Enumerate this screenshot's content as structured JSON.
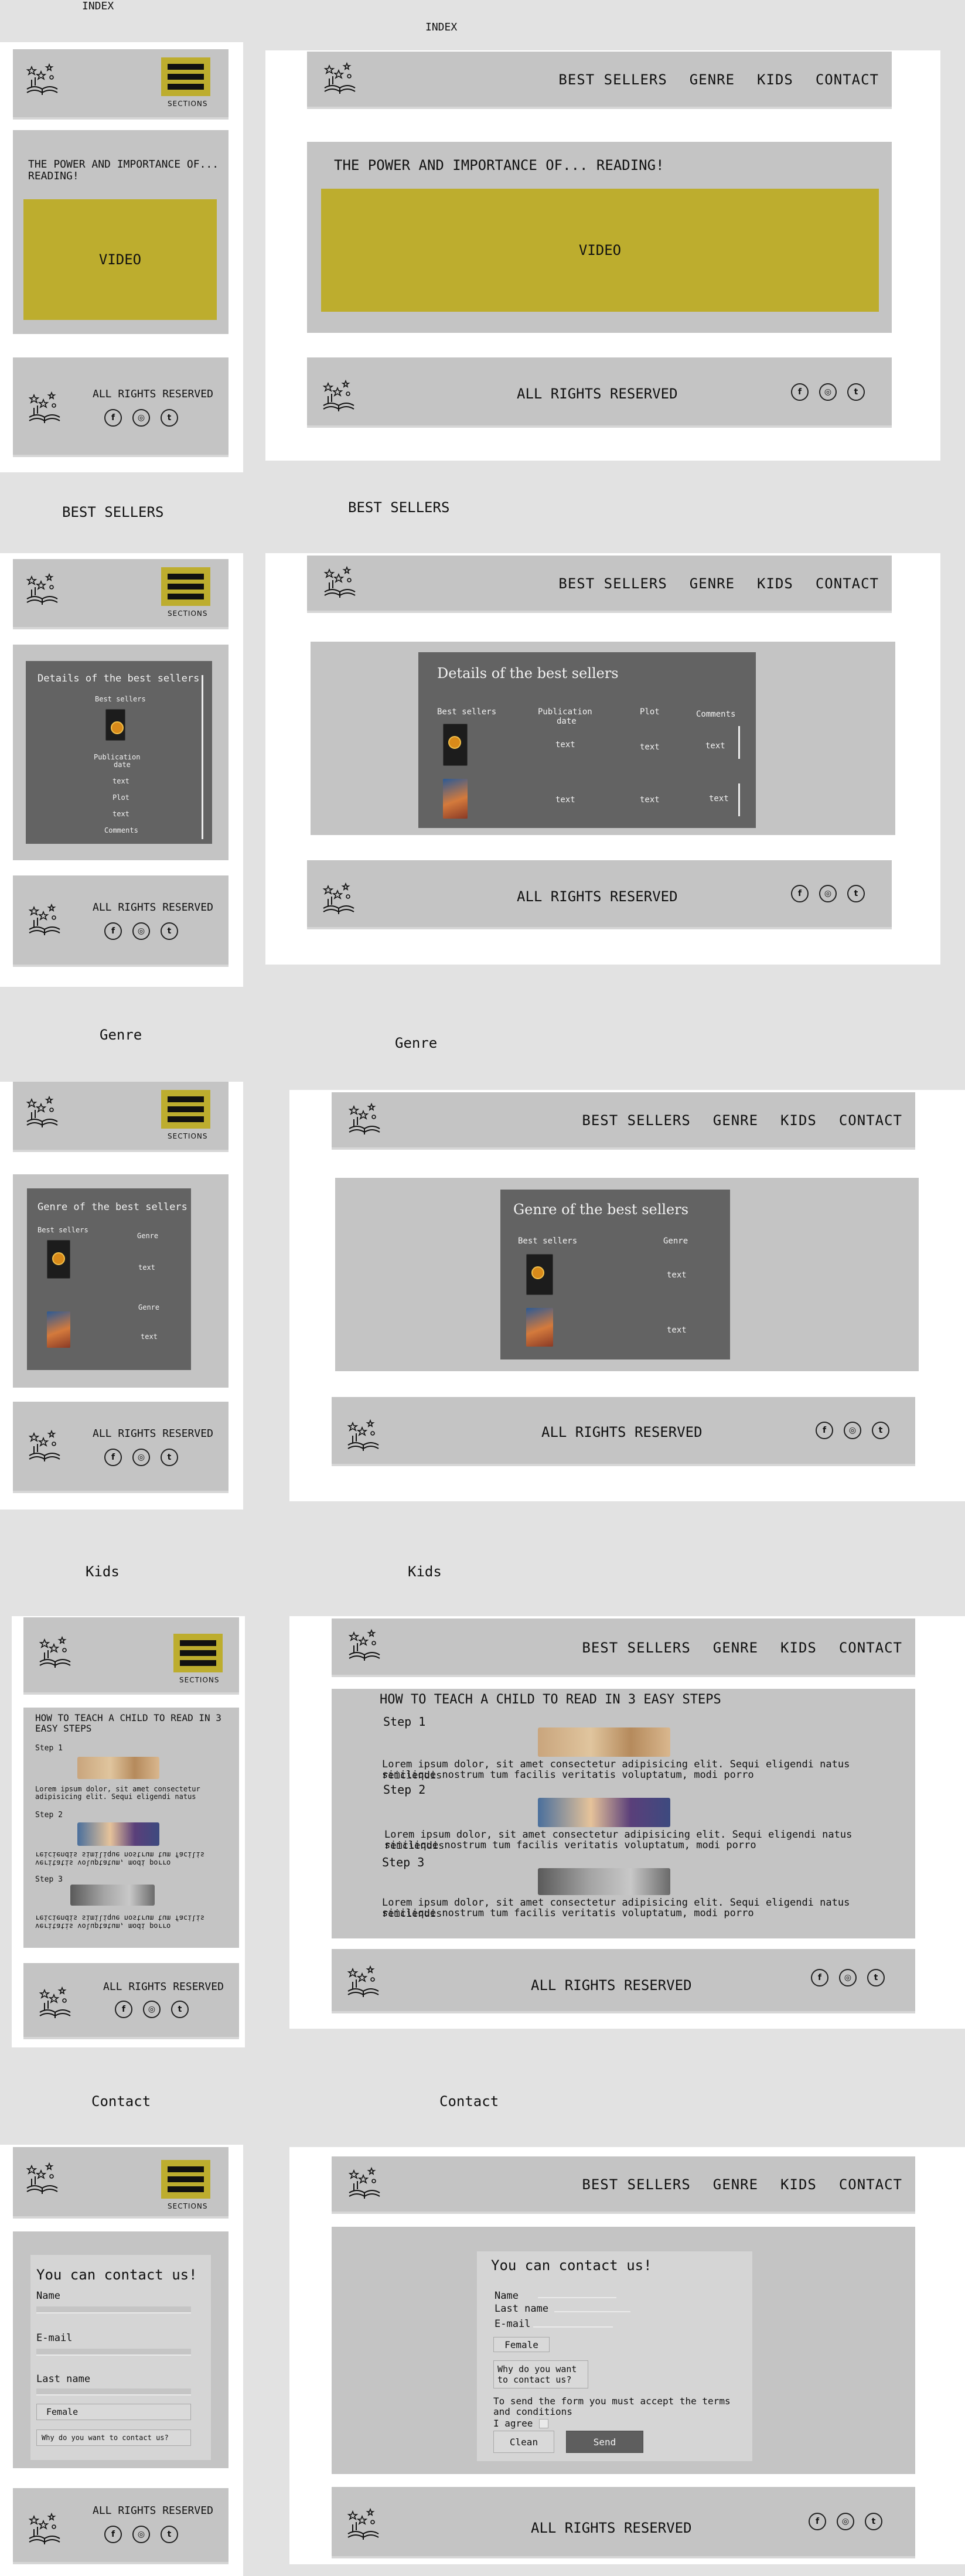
{
  "brand": {
    "sections_label": "SECTIONS"
  },
  "nav": {
    "best_sellers": "BEST SELLERS",
    "genre": "GENRE",
    "kids": "KIDS",
    "contact": "CONTACT"
  },
  "footer": {
    "rights": "ALL RIGHTS RESERVED",
    "social": [
      "f",
      "◎",
      "t"
    ]
  },
  "index": {
    "title": "INDEX",
    "heading_mobile_line1": "THE POWER AND IMPORTANCE OF...",
    "heading_mobile_line2": "READING!",
    "heading_desktop": "THE POWER AND IMPORTANCE OF... READING!",
    "video_label": "VIDEO"
  },
  "best_sellers": {
    "title": "BEST SELLERS",
    "panel_title": "Details of the best sellers",
    "col_best_sellers": "Best sellers",
    "col_pub_line1": "Publication",
    "col_pub_line2": "date",
    "col_plot": "Plot",
    "col_comments": "Comments",
    "cell": "text"
  },
  "genre": {
    "title": "Genre",
    "panel_title": "Genre of the best sellers",
    "col_best_sellers": "Best sellers",
    "col_genre": "Genre",
    "cell": "text"
  },
  "kids": {
    "title": "Kids",
    "heading_desktop": "HOW TO TEACH A CHILD TO READ IN 3 EASY STEPS",
    "heading_mobile_line1": "HOW TO TEACH A CHILD TO READ IN 3",
    "heading_mobile_line2": "EASY STEPS",
    "steps": [
      "Step 1",
      "Step 2",
      "Step 3"
    ],
    "lorem_line1": "Lorem ipsum dolor, sit amet consectetur adipisicing elit. Sequi eligendi natus reiciendis",
    "lorem_line2": "similique nostrum tum facilis veritatis voluptatum, modi porro",
    "lorem_mobile_line1": "Lorem ipsum dolor, sit amet consectetur",
    "lorem_mobile_line2": "adipisicing elit. Sequi eligendi natus",
    "lorem_mobile_flip1": "reiciendis similique nostrum tum facilis",
    "lorem_mobile_flip2": "veritatis voluptatum, modi porro"
  },
  "contact": {
    "title": "Contact",
    "heading": "You can contact us!",
    "name": "Name",
    "last_name": "Last name",
    "email": "E-mail",
    "email_mobile": "E-mail",
    "gender_value": "Female",
    "why_line1": "Why do you want",
    "why_line2": "to contact us?",
    "why_mobile": "Why do you want to contact us?",
    "terms_line1": "To send the form you must accept the terms",
    "terms_line2": "and conditions",
    "agree": "I agree",
    "clean": "Clean",
    "send": "Send"
  },
  "colors": {
    "accent": "#bdad2e",
    "panel": "#c4c4c4",
    "dark_panel": "#636363",
    "send_button": "#5e5e5e"
  }
}
